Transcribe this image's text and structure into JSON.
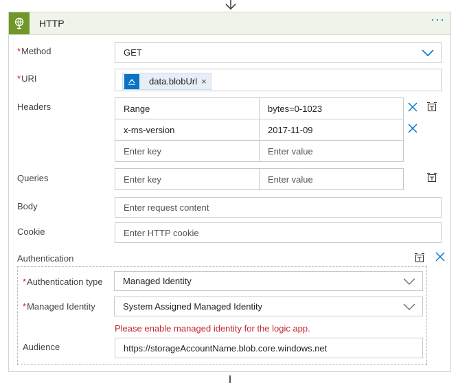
{
  "card": {
    "title": "HTTP",
    "more": "···"
  },
  "method": {
    "label": "Method",
    "required": "*",
    "value": "GET"
  },
  "uri": {
    "label": "URI",
    "required": "*",
    "token": "data.blobUrl",
    "token_remove": "×"
  },
  "headers": {
    "label": "Headers",
    "rows": [
      {
        "key": "Range",
        "value": "bytes=0-1023"
      },
      {
        "key": "x-ms-version",
        "value": "2017-11-09"
      }
    ],
    "key_placeholder": "Enter key",
    "value_placeholder": "Enter value"
  },
  "queries": {
    "label": "Queries",
    "key_placeholder": "Enter key",
    "value_placeholder": "Enter value"
  },
  "body": {
    "label": "Body",
    "placeholder": "Enter request content"
  },
  "cookie": {
    "label": "Cookie",
    "placeholder": "Enter HTTP cookie"
  },
  "authentication": {
    "label": "Authentication",
    "type_label": "Authentication type",
    "type_required": "*",
    "type_value": "Managed Identity",
    "identity_label": "Managed Identity",
    "identity_required": "*",
    "identity_value": "System Assigned Managed Identity",
    "error": "Please enable managed identity for the logic app.",
    "audience_label": "Audience",
    "audience_value": "https://storageAccountName.blob.core.windows.net"
  },
  "colors": {
    "accent": "#0078d4",
    "header_bg": "#eef4ea",
    "tile": "#709727",
    "error": "#c4262e"
  },
  "icons": [
    "arrow-down-icon",
    "globe-icon",
    "ellipsis-icon",
    "chevron-down-icon",
    "variable-token-icon",
    "close-icon",
    "switch-to-text-mode-icon"
  ]
}
